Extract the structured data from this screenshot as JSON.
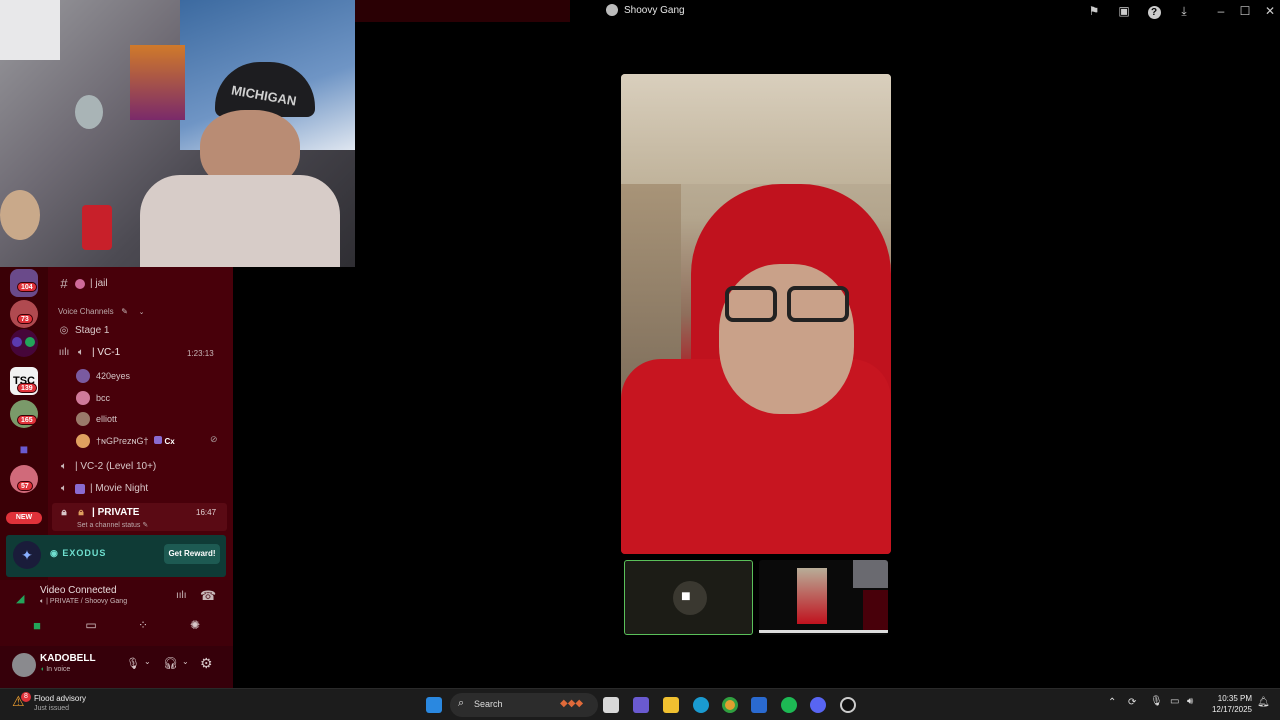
{
  "window": {
    "title": "Shoovy Gang"
  },
  "titlebar_icons": [
    "flag-icon",
    "inbox-icon",
    "help-icon",
    "download-icon"
  ],
  "window_controls": [
    "minimize-icon",
    "maximize-icon",
    "close-icon"
  ],
  "webcam": {
    "label": "MICHIGAN"
  },
  "rail": {
    "servers": [
      {
        "name": "server-1",
        "badge": "104",
        "color": "#6a4a8a"
      },
      {
        "name": "server-2",
        "badge": "73",
        "color": "#b04a50"
      },
      {
        "name": "server-3",
        "badge": "",
        "color": "#5b3ab0"
      },
      {
        "name": "server-4",
        "badge": "139",
        "color": "#f2f2f2"
      },
      {
        "name": "server-5",
        "badge": "165",
        "color": "#7a9a6a"
      },
      {
        "name": "server-6",
        "badge": "",
        "color": "#6a5ad0"
      },
      {
        "name": "server-7",
        "badge": "57",
        "color": "#d06a7a"
      }
    ],
    "new_label": "NEW"
  },
  "channels": {
    "jail": "| jail",
    "voice_header": "Voice Channels",
    "stage": "Stage 1",
    "vc1": "| VC-1",
    "vc1_time": "1:23:13",
    "vc1_users": [
      "420eyes",
      "bcc",
      "elliott",
      "†ɴGPrezɴG†"
    ],
    "vc1_user_tag": "Cx",
    "vc2": "| VC-2 (Level 10+)",
    "movie": "| Movie Night",
    "private": "| PRIVATE",
    "private_time": "16:47",
    "private_status": "Set a channel status"
  },
  "promo": {
    "brand": "EXODUS",
    "button": "Get Reward!"
  },
  "voice": {
    "status": "Video Connected",
    "location": "| PRIVATE / Shoovy Gang"
  },
  "user": {
    "name": "KADOBELL",
    "status": "In voice"
  },
  "taskbar": {
    "notification_title": "Flood advisory",
    "notification_sub": "Just issued",
    "notification_count": "8",
    "search_placeholder": "Search",
    "time": "10:35 PM",
    "date": "12/17/2025"
  },
  "colors": {
    "accent_red": "#e0323a",
    "sidebar_bg": "#48000a",
    "voice_green": "#23a55a"
  }
}
